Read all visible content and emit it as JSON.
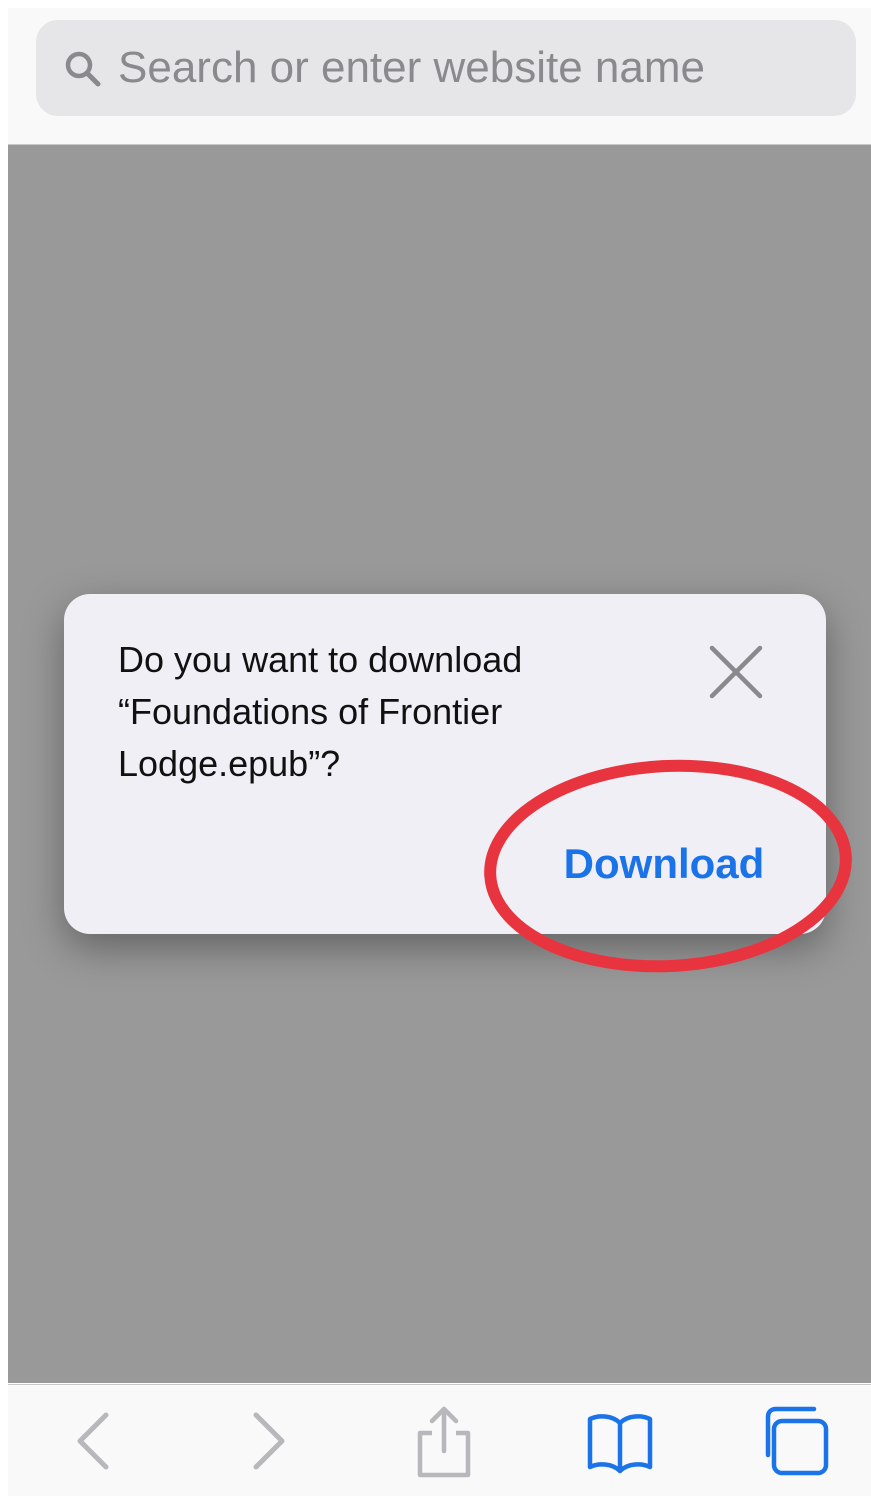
{
  "search": {
    "placeholder": "Search or enter website name"
  },
  "dialog": {
    "message": "Do you want to download “Foundations of Frontier Lodge.epub”?",
    "download_label": "Download"
  },
  "toolbar": {
    "icons": [
      "back-chevron-icon",
      "forward-chevron-icon",
      "share-icon",
      "bookmarks-book-icon",
      "tabs-icon"
    ]
  },
  "colors": {
    "accent": "#1a73e8",
    "annotation": "#e8343f",
    "overlay": "#999999",
    "dialog_bg": "#f0eff5",
    "disabled_icon": "#b8b8bc"
  }
}
